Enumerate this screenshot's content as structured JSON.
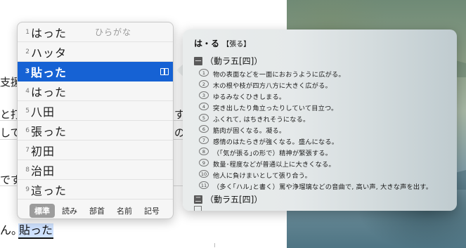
{
  "document": {
    "fragments": [
      "支援",
      "と打ち",
      "してす",
      "です",
      "すぐ",
      "の"
    ],
    "prefix": "ん。",
    "composing": "貼った"
  },
  "candidates": {
    "items": [
      {
        "num": "1",
        "text": "はった",
        "hint": "ひらがな"
      },
      {
        "num": "2",
        "text": "ハッタ"
      },
      {
        "num": "3",
        "text": "貼った",
        "selected": true
      },
      {
        "num": "4",
        "text": "はった"
      },
      {
        "num": "5",
        "text": "八田"
      },
      {
        "num": "6",
        "text": "張った"
      },
      {
        "num": "7",
        "text": "初田"
      },
      {
        "num": "8",
        "text": "治田"
      },
      {
        "num": "9",
        "text": "這った"
      }
    ],
    "tabs": [
      "標準",
      "読み",
      "部首",
      "名前",
      "記号"
    ],
    "active_tab": "標準",
    "selected_color": "#1662d4"
  },
  "dictionary": {
    "reading": "は・る",
    "kanji": "【張る】",
    "sections": [
      {
        "mark": "一",
        "label": "（動ラ五[四]）"
      },
      {
        "mark": "二",
        "label": "（動ラ五[四]）"
      }
    ],
    "definitions": [
      {
        "n": "1",
        "text": "物の表面などを一面におおうように広がる。"
      },
      {
        "n": "2",
        "text": "木の根や枝が四方八方に大きく広がる。"
      },
      {
        "n": "3",
        "text": "ゆるみなくひきしまる。"
      },
      {
        "n": "4",
        "text": "突き出したり角立ったりしていて目立つ。"
      },
      {
        "n": "5",
        "text": "ふくれて, はちきれそうになる。"
      },
      {
        "n": "6",
        "text": "筋肉が固くなる。凝る。"
      },
      {
        "n": "7",
        "text": "感情のはたらきが強くなる。盛んになる。"
      },
      {
        "n": "8",
        "text": "（｢気が張る｣の形で）精神が緊張する。"
      },
      {
        "n": "9",
        "text": "数量･程度などが普通以上に大きくなる。"
      },
      {
        "n": "10",
        "text": "他人に負けまいとして張り合う。"
      },
      {
        "n": "11",
        "text": "（多く｢ハル｣と書く）罵や浄瑠璃などの音曲で, 高い声, 大きな声を出す。"
      }
    ]
  }
}
